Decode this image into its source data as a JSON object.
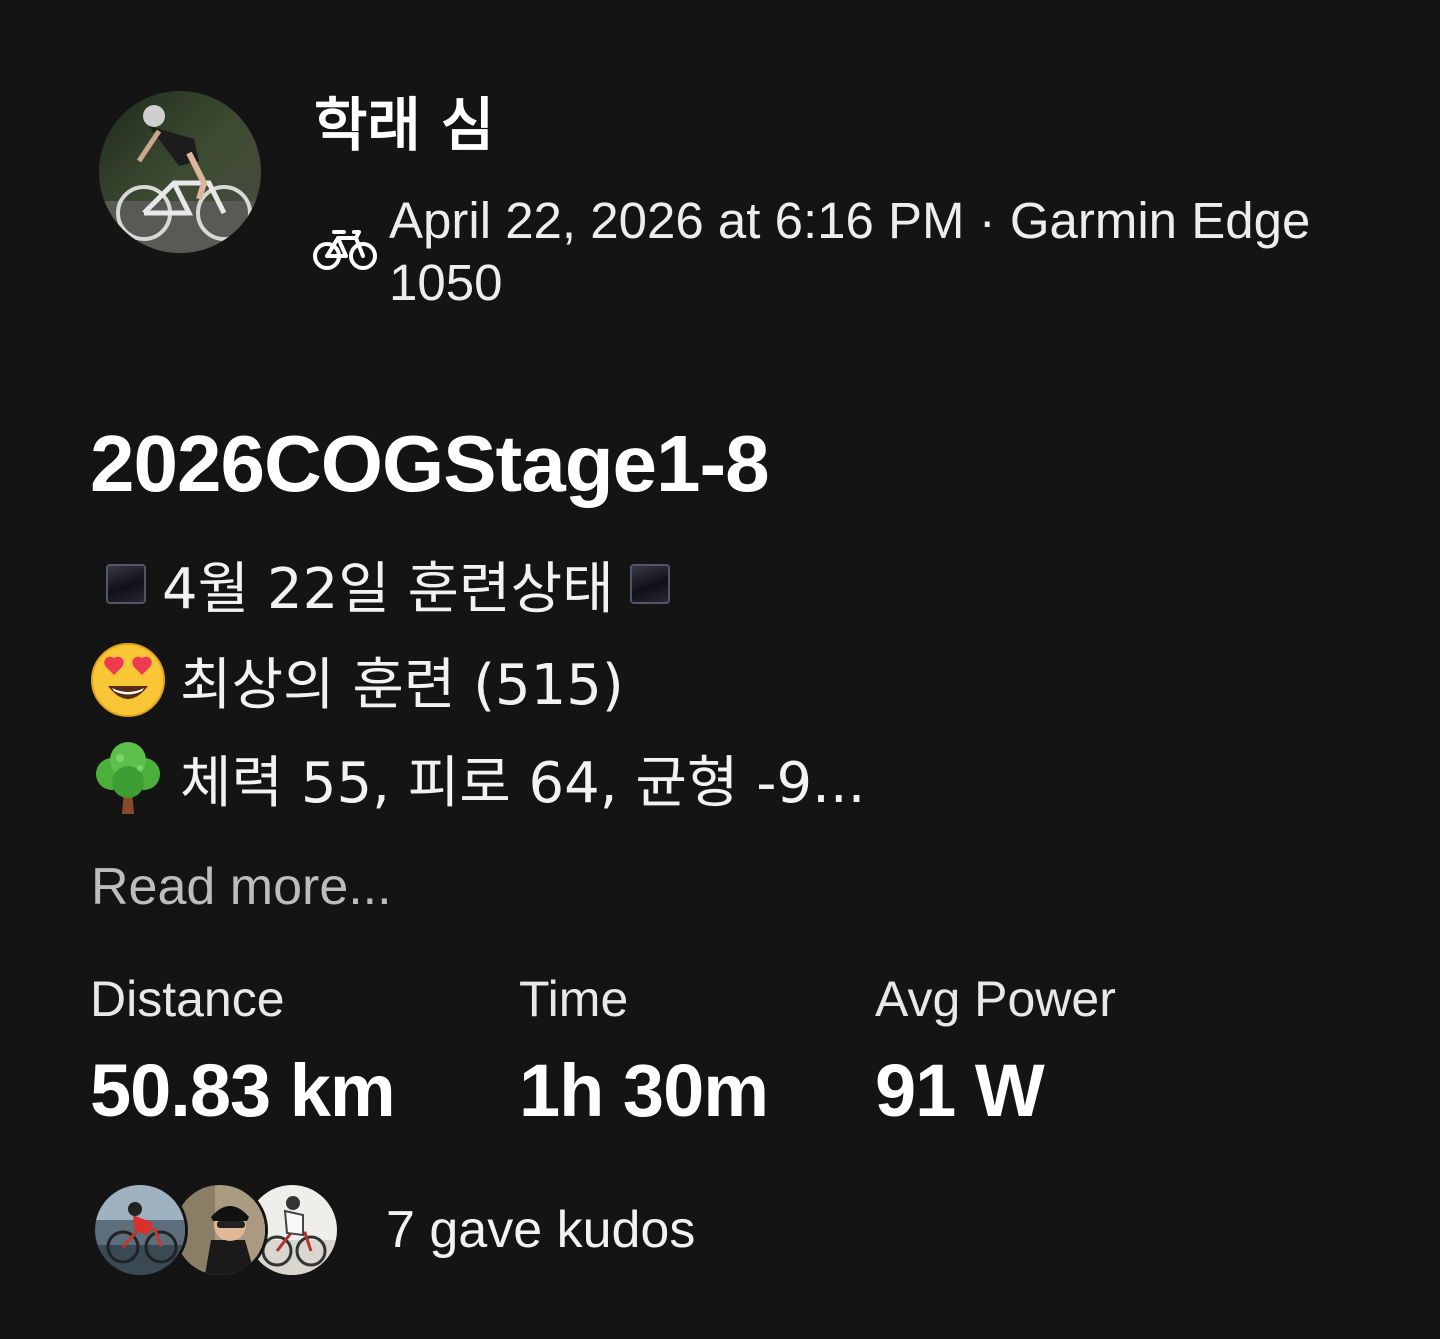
{
  "header": {
    "athlete_name": "학래 심",
    "avatar_icon": "cyclist-avatar",
    "sport_icon": "bicycle-icon",
    "meta": "April 22, 2026 at 6:16 PM · Garmin Edge 1050"
  },
  "activity": {
    "title": "2026COGStage1-8",
    "description": [
      {
        "emoji": "black-square-emoji",
        "text": "4월 22일 훈련상태",
        "trailing_emoji": "black-square-emoji"
      },
      {
        "emoji": "heart-eyes-emoji",
        "text": "최상의 훈련 (515)"
      },
      {
        "emoji": "tree-emoji",
        "text": "체력 55, 피로 64, 균형 -9..."
      }
    ],
    "read_more": "Read more..."
  },
  "stats": [
    {
      "label": "Distance",
      "value": "50.83 km"
    },
    {
      "label": "Time",
      "value": "1h 30m"
    },
    {
      "label": "Avg Power",
      "value": "91 W"
    }
  ],
  "kudos": {
    "avatars": [
      "cyclist-red-avatar",
      "helmet-portrait-avatar",
      "cyclist-white-avatar"
    ],
    "text": "7 gave kudos"
  },
  "colors": {
    "background": "#141414",
    "text_primary": "#ffffff",
    "text_muted": "#bdbdbd"
  }
}
